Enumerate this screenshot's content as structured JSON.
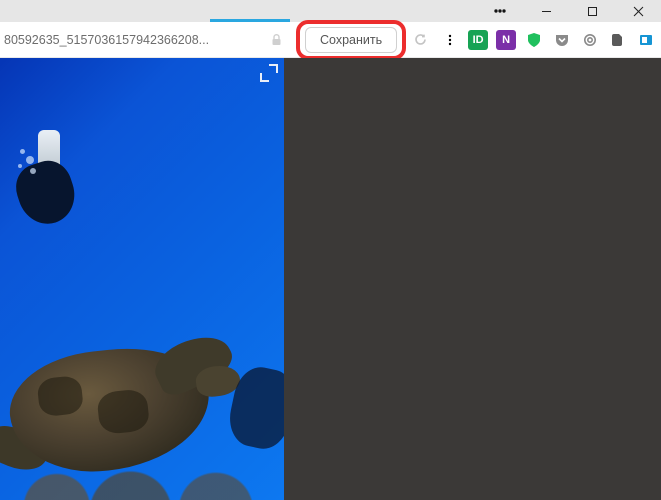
{
  "window_controls": {
    "menu": "menu",
    "minimize": "minimize",
    "maximize": "maximize",
    "close": "close"
  },
  "toolbar": {
    "url_fragment": "80592635_5157036157942366208...",
    "lock": "lock-icon",
    "save_label": "Сохранить",
    "reload": "reload",
    "extensions": [
      {
        "name": "menu-dots-icon",
        "label": "⋮"
      },
      {
        "name": "id-extension-icon",
        "label": "ID"
      },
      {
        "name": "onenote-extension-icon",
        "label": "N"
      },
      {
        "name": "shield-green-icon",
        "label": ""
      },
      {
        "name": "pocket-extension-icon",
        "label": ""
      },
      {
        "name": "circle-extension-icon",
        "label": ""
      },
      {
        "name": "evernote-extension-icon",
        "label": ""
      },
      {
        "name": "clip-extension-icon",
        "label": ""
      },
      {
        "name": "download-icon",
        "label": ""
      }
    ]
  },
  "content": {
    "fullscreen": "fullscreen-icon"
  }
}
